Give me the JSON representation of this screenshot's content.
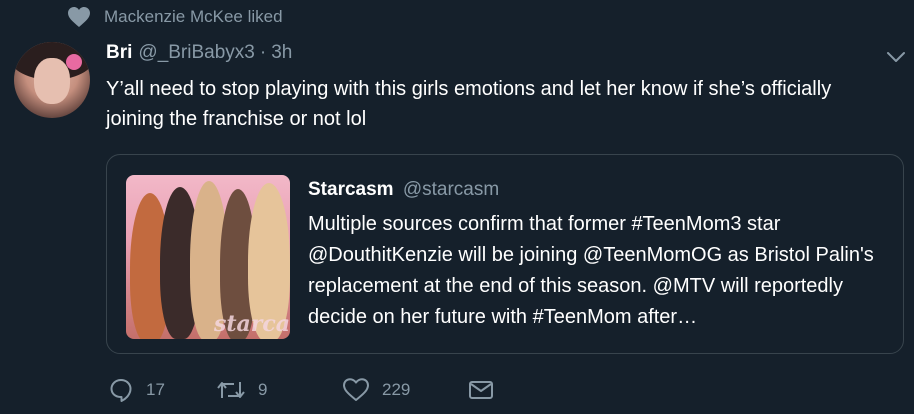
{
  "social_context": {
    "text": "Mackenzie McKee liked"
  },
  "tweet": {
    "name": "Bri",
    "handle": "@_BriBabyx3",
    "dot": "·",
    "time": "3h",
    "text": "Y’all need to stop playing with this girls emotions and let her know if she’s officially joining the franchise or not lol"
  },
  "quote": {
    "name": "Starcasm",
    "handle": "@starcasm",
    "text": "Multiple sources confirm that former #TeenMom3 star @DouthitKenzie will be joining @TeenMomOG as Bristol Palin's replacement at the end of this season. @MTV will reportedly decide on her future with #TeenMom after…",
    "thumbnail_watermark": "starcasm"
  },
  "actions": {
    "reply_count": "17",
    "retweet_count": "9",
    "like_count": "229"
  },
  "colors": {
    "background": "#15202b",
    "secondary_text": "#8899a6",
    "border": "#38444d"
  },
  "icons": [
    "heart-icon",
    "chevron-down-icon",
    "reply-icon",
    "retweet-icon",
    "like-icon",
    "message-icon"
  ]
}
